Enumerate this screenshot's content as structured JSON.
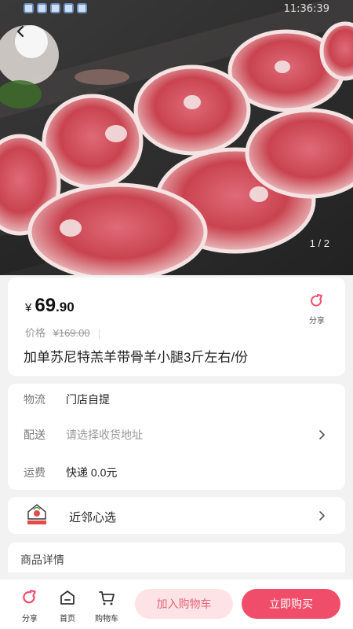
{
  "status_bar": {
    "time": "11:36:39",
    "icons": [
      "app-icon",
      "app-icon",
      "app-icon",
      "app-icon",
      "app-icon"
    ]
  },
  "gallery": {
    "current": "1",
    "separator": "/",
    "total": "2"
  },
  "price": {
    "currency": "¥",
    "integer": "69",
    "decimal": ".90"
  },
  "original_price": {
    "label": "价格",
    "value": "¥169.00"
  },
  "share": {
    "label": "分享"
  },
  "product": {
    "title": "加单苏尼特羔羊带骨羊小腿3斤左右/份"
  },
  "delivery": {
    "logistics_label": "物流",
    "logistics_value": "门店自提",
    "ship_label": "配送",
    "ship_placeholder": "请选择收货地址",
    "fee_label": "运费",
    "fee_value": "快递 0.0元"
  },
  "store": {
    "name": "近邻心选",
    "logo_text": "近邻心选"
  },
  "details": {
    "title": "商品详情"
  },
  "bottom_bar": {
    "share_label": "分享",
    "home_label": "首页",
    "cart_label": "购物车",
    "add_to_cart": "加入购物车",
    "buy_now": "立即购买"
  },
  "colors": {
    "accent": "#f04d6a",
    "accent_light": "#fde3e6"
  }
}
